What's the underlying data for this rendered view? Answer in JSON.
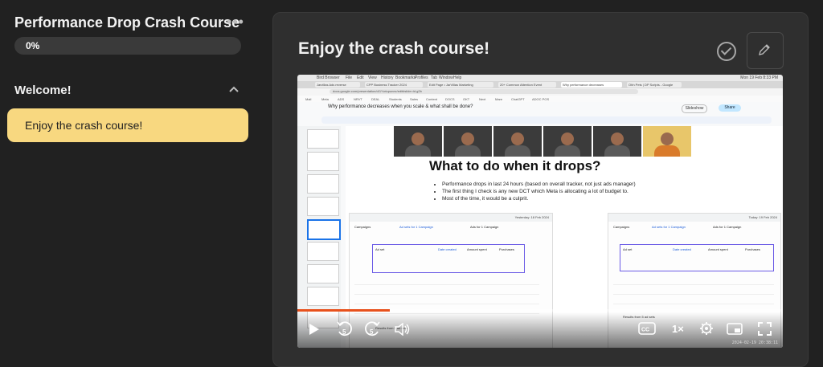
{
  "sidebar": {
    "course_title": "Performance Drop Crash Course",
    "progress": {
      "label": "0%",
      "value": 0
    },
    "section": {
      "title": "Welcome!"
    },
    "lessons": [
      {
        "label": "Enjoy the crash course!",
        "active": true
      }
    ]
  },
  "main": {
    "lesson_title": "Enjoy the crash course!",
    "video": {
      "progress_fraction": 0.19,
      "playback_speed": "1×",
      "timestamp": "2024-02-19  20:38:11",
      "screen": {
        "mac_menu": [
          "Bird Browser",
          "File",
          "Edit",
          "View",
          "History",
          "Bookmarks",
          "Profiles",
          "Tab",
          "Window",
          "Help"
        ],
        "mac_clock": "Mon 19 Feb 8:33 PM",
        "browser_tabs": [
          "Jarvillas Ads reverse",
          "CPP Business Tracker 2024",
          "Edit Page • JarVillas Marketing",
          "20+ Common Attention Event",
          "Why performance decreases",
          "Ohh Pets | DP Scripts - Google"
        ],
        "url": "docs.google.com/presentation/d/1Ywiupunez/edit#slide=id.g2b",
        "bookmarks": [
          "Mail",
          "Meta",
          "ADS",
          "NRVT",
          "DEAL",
          "Students",
          "Sales",
          "Content",
          "DOCS",
          "OKT",
          "Next",
          "Mare",
          "ChatGPT",
          "ADOC POS"
        ],
        "doc_title": "Why performance decreases when you scale & what shall be done?",
        "slideshow_label": "Slideshow",
        "share_label": "Share",
        "slide": {
          "heading": "What to do when it drops?",
          "bullets": [
            "Performance drops in last 24 hours (based on overall tracker, not just ads manager)",
            "The first thing I check is any new DCT which Meta is allocating a lot of budget to.",
            "Most of the time, it would be a culprit."
          ],
          "left_shot": {
            "date": "Yesterday: 18 Feb 2024",
            "tab1": "Campaigns",
            "tab2": "Ad sets for 1 Campaign",
            "tab3": "Ads for 1 Campaign",
            "col1": "Ad set",
            "col2": "Date created",
            "col3": "Amount spent",
            "col4": "Purchases",
            "footer": "Results from 5 ad sets"
          },
          "right_shot": {
            "date": "Today: 19 Feb 2024",
            "tab1": "Campaigns",
            "tab2": "Ad sets for 1 Campaign",
            "tab3": "Ads for 1 Campaign",
            "col1": "Ad set",
            "col2": "Date created",
            "col3": "Amount spent",
            "col4": "Purchases",
            "footer": "Results from 5 ad sets"
          }
        }
      }
    }
  },
  "colors": {
    "lesson_active_bg": "#f8d880",
    "progress_accent": "#e8511c",
    "background": "#212121",
    "card": "#2f2f2f"
  },
  "icons": [
    "more-icon",
    "chevron-up-icon",
    "check-circle-icon",
    "pencil-icon",
    "play-icon",
    "rewind-5-icon",
    "forward-5-icon",
    "volume-icon",
    "captions-icon",
    "settings-icon",
    "pip-icon",
    "fullscreen-icon"
  ]
}
